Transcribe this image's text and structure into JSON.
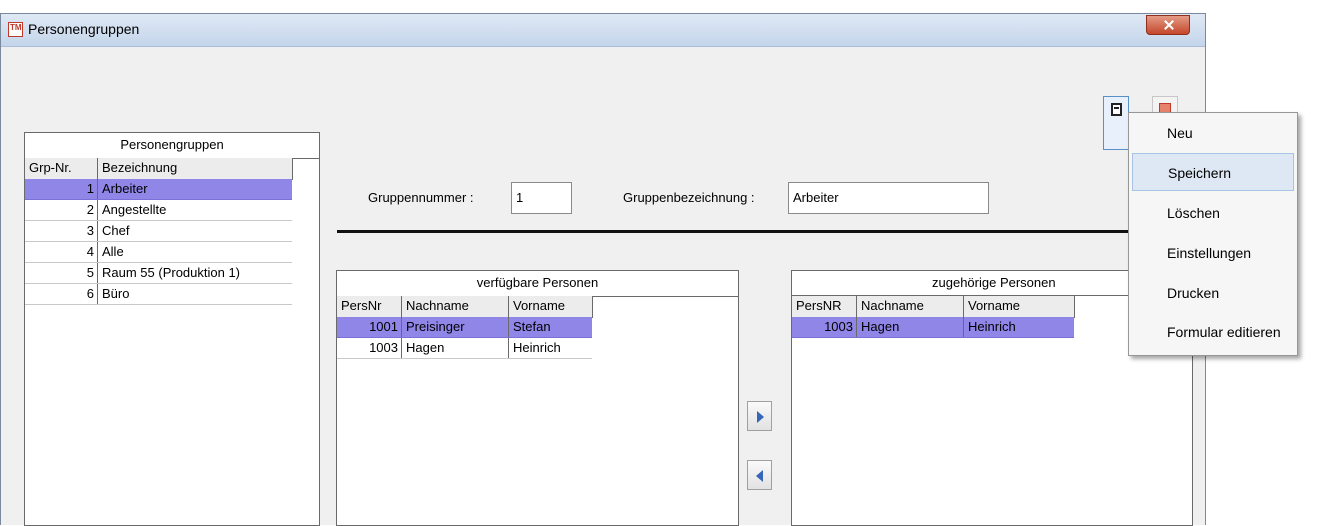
{
  "window": {
    "title": "Personengruppen",
    "icon": "TM"
  },
  "groups_panel": {
    "title": "Personengruppen",
    "columns": [
      "Grp-Nr.",
      "Bezeichnung"
    ],
    "rows": [
      {
        "nr": "1",
        "name": "Arbeiter",
        "selected": true
      },
      {
        "nr": "2",
        "name": "Angestellte",
        "selected": false
      },
      {
        "nr": "3",
        "name": "Chef",
        "selected": false
      },
      {
        "nr": "4",
        "name": "Alle",
        "selected": false
      },
      {
        "nr": "5",
        "name": "Raum 55 (Produktion 1)",
        "selected": false
      },
      {
        "nr": "6",
        "name": "Büro",
        "selected": false
      }
    ]
  },
  "form": {
    "group_number_label": "Gruppennummer :",
    "group_number_value": "1",
    "group_name_label": "Gruppenbezeichnung :",
    "group_name_value": "Arbeiter"
  },
  "available_panel": {
    "title": "verfügbare Personen",
    "columns": [
      "PersNr",
      "Nachname",
      "Vorname"
    ],
    "rows": [
      {
        "nr": "1001",
        "last": "Preisinger",
        "first": "Stefan",
        "selected": true
      },
      {
        "nr": "1003",
        "last": "Hagen",
        "first": "Heinrich",
        "selected": false
      }
    ]
  },
  "assigned_panel": {
    "title": "zugehörige Personen",
    "columns": [
      "PersNR",
      "Nachname",
      "Vorname"
    ],
    "rows": [
      {
        "nr": "1003",
        "last": "Hagen",
        "first": "Heinrich",
        "selected": true
      }
    ]
  },
  "context_menu": {
    "items": [
      "Neu",
      "Speichern",
      "Löschen",
      "Einstellungen",
      "Drucken",
      "Formular editieren"
    ],
    "highlighted": "Speichern"
  },
  "colors": {
    "selection": "#8f86e8",
    "menu_highlight": "#dde8f4"
  }
}
